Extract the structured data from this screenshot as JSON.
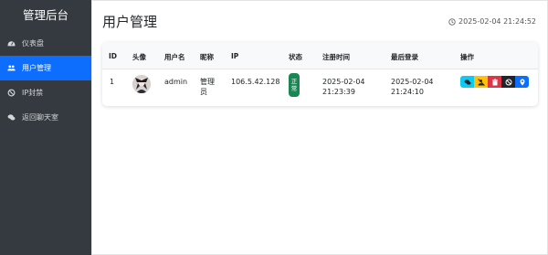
{
  "sidebar": {
    "brand": "管理后台",
    "items": [
      {
        "label": "仪表盘",
        "icon": "dashboard-icon"
      },
      {
        "label": "用户管理",
        "icon": "users-icon",
        "active": true
      },
      {
        "label": "IP封禁",
        "icon": "ban-icon"
      },
      {
        "label": "返回聊天室",
        "icon": "chat-icon"
      }
    ]
  },
  "header": {
    "title": "用户管理",
    "timestamp": "2025-02-04 21:24:52"
  },
  "table": {
    "columns": [
      "ID",
      "头像",
      "用户名",
      "昵称",
      "IP",
      "状态",
      "注册时间",
      "最后登录",
      "操作"
    ],
    "rows": [
      {
        "id": "1",
        "username": "admin",
        "nickname": "管理员",
        "ip": "106.5.42.128",
        "status": "正常",
        "registered": "2025-02-04 21:23:39",
        "last_login": "2025-02-04 21:24:10"
      }
    ]
  },
  "actions": [
    {
      "icon": "chat-icon",
      "color": "#0dcaf0"
    },
    {
      "icon": "mute-user-icon",
      "color": "#ffc107"
    },
    {
      "icon": "trash-icon",
      "color": "#dc3545"
    },
    {
      "icon": "ban-icon",
      "color": "#212529"
    },
    {
      "icon": "location-icon",
      "color": "#0d6efd"
    }
  ],
  "colors": {
    "sidebar_bg": "#343a40",
    "active": "#0d6efd",
    "status_ok": "#198754"
  }
}
